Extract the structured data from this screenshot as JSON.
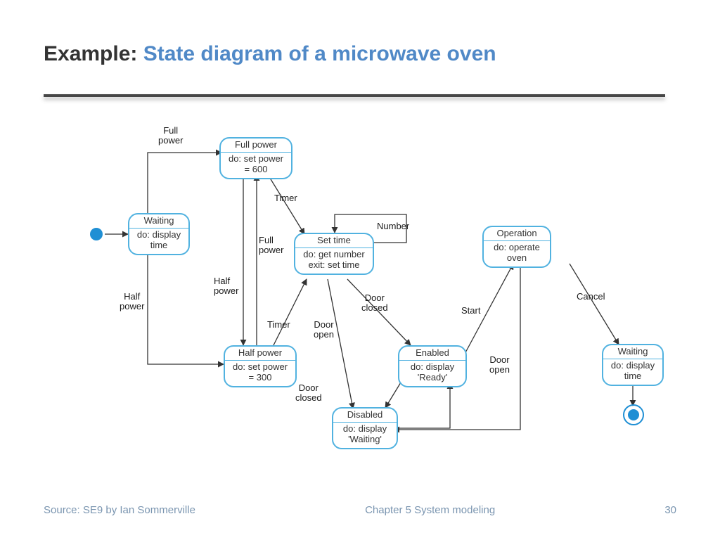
{
  "title": {
    "prefix": "Example:",
    "accent": "State diagram of a microwave oven"
  },
  "footer": {
    "source": "Source: SE9 by Ian Sommerville",
    "chapter": "Chapter 5 System modeling",
    "page": "30"
  },
  "states": {
    "waiting1": {
      "name": "Waiting",
      "act": "do: display\ntime"
    },
    "fullpower": {
      "name": "Full power",
      "act": "do: set power\n= 600"
    },
    "halfpower": {
      "name": "Half power",
      "act": "do: set power\n= 300"
    },
    "settime": {
      "name": "Set time",
      "act": "do: get number\nexit: set time"
    },
    "enabled": {
      "name": "Enabled",
      "act": "do: display\n'Ready'"
    },
    "disabled": {
      "name": "Disabled",
      "act": "do: display\n'Waiting'"
    },
    "operation": {
      "name": "Operation",
      "act": "do: operate\noven"
    },
    "waiting2": {
      "name": "Waiting",
      "act": "do: display\ntime"
    }
  },
  "labels": {
    "fullpower1": "Full\npower",
    "halfpower1": "Half\npower",
    "fullpower2": "Full\npower",
    "halfpower2": "Half\npower",
    "timer1": "Timer",
    "timer2": "Timer",
    "number": "Number",
    "doorclosed1": "Door\nclosed",
    "dooropen1": "Door\nopen",
    "doorclosed2": "Door\nclosed",
    "start": "Start",
    "dooropen2": "Door\nopen",
    "cancel": "Cancel"
  }
}
